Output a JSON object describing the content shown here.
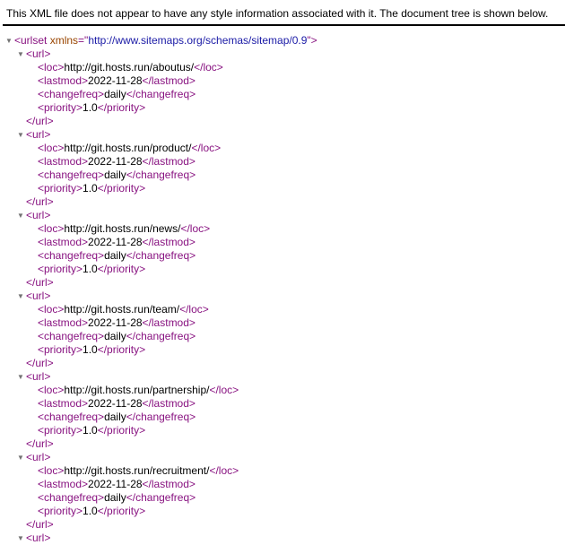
{
  "notice": "This XML file does not appear to have any style information associated with it. The document tree is shown below.",
  "toggle_glyph": "▼",
  "urlset": {
    "open_prefix": "<urlset",
    "attr_name": " xmlns",
    "attr_eq": "=\"",
    "attr_value": "http://www.sitemaps.org/schemas/sitemap/0.9",
    "open_suffix": "\">"
  },
  "tags": {
    "url_open": "<url>",
    "url_close": "</url>",
    "loc_open": "<loc>",
    "loc_close": "</loc>",
    "lastmod_open": "<lastmod>",
    "lastmod_close": "</lastmod>",
    "changefreq_open": "<changefreq>",
    "changefreq_close": "</changefreq>",
    "priority_open": "<priority>",
    "priority_close": "</priority>",
    "url_partial": "<url>"
  },
  "urls": [
    {
      "loc": "http://git.hosts.run/aboutus/",
      "lastmod": "2022-11-28",
      "changefreq": "daily",
      "priority": "1.0"
    },
    {
      "loc": "http://git.hosts.run/product/",
      "lastmod": "2022-11-28",
      "changefreq": "daily",
      "priority": "1.0"
    },
    {
      "loc": "http://git.hosts.run/news/",
      "lastmod": "2022-11-28",
      "changefreq": "daily",
      "priority": "1.0"
    },
    {
      "loc": "http://git.hosts.run/team/",
      "lastmod": "2022-11-28",
      "changefreq": "daily",
      "priority": "1.0"
    },
    {
      "loc": "http://git.hosts.run/partnership/",
      "lastmod": "2022-11-28",
      "changefreq": "daily",
      "priority": "1.0"
    },
    {
      "loc": "http://git.hosts.run/recruitment/",
      "lastmod": "2022-11-28",
      "changefreq": "daily",
      "priority": "1.0"
    }
  ]
}
